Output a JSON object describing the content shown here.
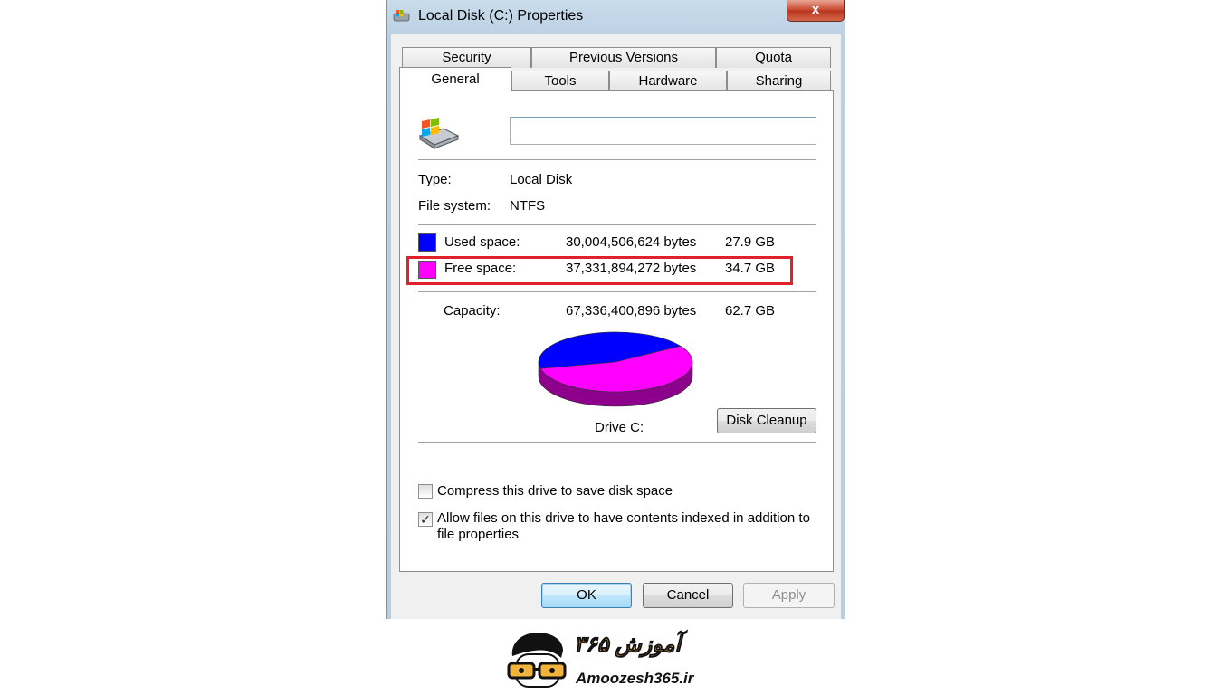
{
  "window": {
    "title": "Local Disk (C:) Properties",
    "close_label": "x"
  },
  "tabs_back": [
    "Security",
    "Previous Versions",
    "Quota"
  ],
  "tabs_front": [
    "General",
    "Tools",
    "Hardware",
    "Sharing"
  ],
  "general": {
    "name_value": "",
    "type_label": "Type:",
    "type_value": "Local Disk",
    "fs_label": "File system:",
    "fs_value": "NTFS",
    "used": {
      "label": "Used space:",
      "bytes": "30,004,506,624 bytes",
      "size": "27.9 GB",
      "color": "#0000ff"
    },
    "free": {
      "label": "Free space:",
      "bytes": "37,331,894,272 bytes",
      "size": "34.7 GB",
      "color": "#ff00ff"
    },
    "capacity": {
      "label": "Capacity:",
      "bytes": "67,336,400,896 bytes",
      "size": "62.7 GB"
    },
    "drive_label": "Drive C:",
    "disk_cleanup_label": "Disk Cleanup",
    "compress_label": "Compress this drive to save disk space",
    "compress_checked": false,
    "index_label_line1": "Allow files on this drive to have contents indexed in addition to",
    "index_label_line2": "file properties",
    "index_checked": true
  },
  "buttons": {
    "ok": "OK",
    "cancel": "Cancel",
    "apply": "Apply"
  },
  "branding": {
    "site": "Amoozesh365.ir",
    "logo_text": "آموزش ۳۶۵"
  },
  "chart_data": {
    "type": "pie",
    "categories": [
      "Used space",
      "Free space"
    ],
    "values": [
      30004506624,
      37331894272
    ],
    "colors": [
      "#0000ff",
      "#ff00ff"
    ]
  }
}
